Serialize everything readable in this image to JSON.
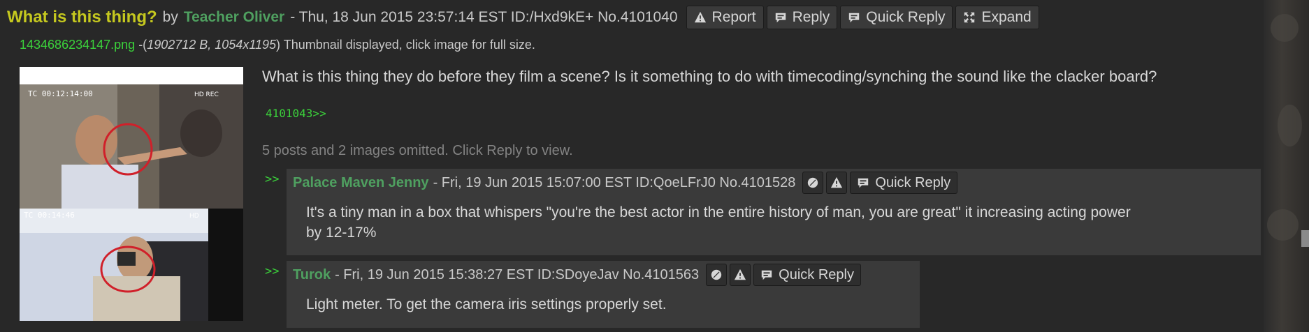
{
  "op": {
    "subject": "What is this thing?",
    "by": "by",
    "name": "Teacher Oliver",
    "meta": "- Thu, 18 Jun 2015 23:57:14 EST ID:/Hxd9kE+ No.4101040",
    "buttons": {
      "report": "Report",
      "reply": "Reply",
      "quick_reply": "Quick Reply",
      "expand": "Expand"
    },
    "file": {
      "name": "1434686234147.png",
      "dash": " -(",
      "size": "1902712 B, 1054x1195",
      "rest": ") Thumbnail displayed, click image for full size."
    },
    "thumbnail_overlays": {
      "top_timecode": "TC  00:12:14:00",
      "top_right": "HD  REC",
      "bottom_timecode": "TC  00:14:46",
      "bottom_right": "HD"
    },
    "body": "What is this thing they do before they film a scene? Is it something to do with timecoding/synching the sound like the clacker board?",
    "quotelink": "4101043>>",
    "omitted": "5 posts and 2 images omitted. Click Reply to view."
  },
  "replies": [
    {
      "arrow": ">>",
      "name": "Palace Maven Jenny",
      "meta": "- Fri, 19 Jun 2015 15:07:00 EST ID:QoeLFrJ0 No.4101528",
      "quick_reply": "Quick Reply",
      "body_line1": "It's a tiny man in a box that whispers \"you're the best actor in the entire history of man, you are great\" it increasing acting power",
      "body_line2": "by 12-17%"
    },
    {
      "arrow": ">>",
      "name": "Turok",
      "meta": "- Fri, 19 Jun 2015 15:38:27 EST ID:SDoyeJav No.4101563",
      "quick_reply": "Quick Reply",
      "body_line1": "Light meter. To get the camera iris settings properly set."
    }
  ],
  "colors": {
    "subject": "#c5c81f",
    "name": "#4fa060",
    "link": "#3bd13b",
    "background": "#282828",
    "reply_background": "#3a3a3a"
  }
}
